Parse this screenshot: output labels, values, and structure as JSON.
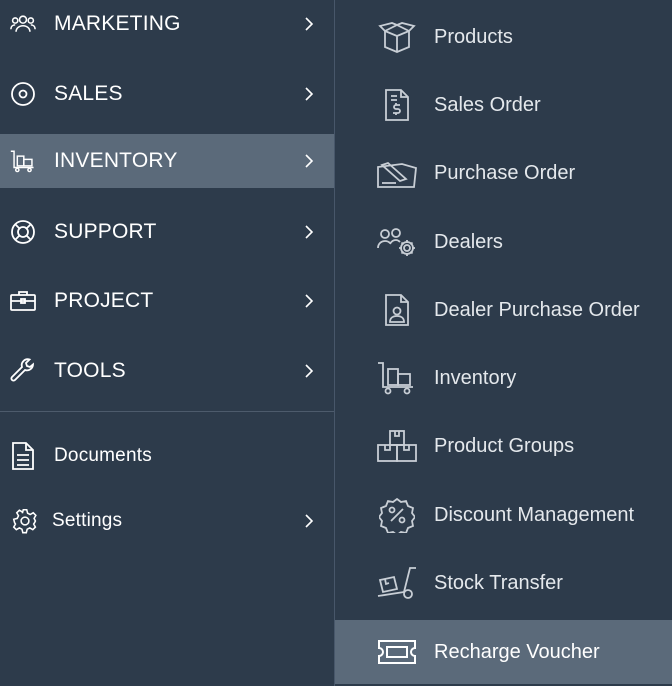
{
  "left_menu": {
    "items": [
      {
        "label": "MARKETING",
        "icon": "people-group-icon",
        "has_submenu": true
      },
      {
        "label": "SALES",
        "icon": "target-icon",
        "has_submenu": true
      },
      {
        "label": "INVENTORY",
        "icon": "cart-boxes-icon",
        "has_submenu": true,
        "active": true
      },
      {
        "label": "SUPPORT",
        "icon": "lifebuoy-icon",
        "has_submenu": true
      },
      {
        "label": "PROJECT",
        "icon": "briefcase-icon",
        "has_submenu": true
      },
      {
        "label": "TOOLS",
        "icon": "wrench-icon",
        "has_submenu": true
      }
    ],
    "extra": [
      {
        "label": "Documents",
        "icon": "document-icon",
        "has_submenu": false
      },
      {
        "label": "Settings",
        "icon": "gear-icon",
        "has_submenu": true
      }
    ]
  },
  "submenu": {
    "items": [
      {
        "label": "Products",
        "icon": "open-box-icon"
      },
      {
        "label": "Sales Order",
        "icon": "dollar-document-icon"
      },
      {
        "label": "Purchase Order",
        "icon": "signed-document-icon"
      },
      {
        "label": "Dealers",
        "icon": "people-gear-icon"
      },
      {
        "label": "Dealer Purchase Order",
        "icon": "person-document-icon"
      },
      {
        "label": "Inventory",
        "icon": "cart-boxes-icon"
      },
      {
        "label": "Product Groups",
        "icon": "stacked-boxes-icon"
      },
      {
        "label": "Discount Management",
        "icon": "percent-badge-icon"
      },
      {
        "label": "Stock Transfer",
        "icon": "hand-truck-icon"
      },
      {
        "label": "Recharge Voucher",
        "icon": "ticket-icon",
        "active": true
      }
    ]
  },
  "colors": {
    "background": "#2d3b4b",
    "active_background": "#5b6a7a",
    "text": "#ffffff",
    "icon_stroke_left": "#ffffff",
    "icon_stroke_sub": "#c8ced5"
  }
}
